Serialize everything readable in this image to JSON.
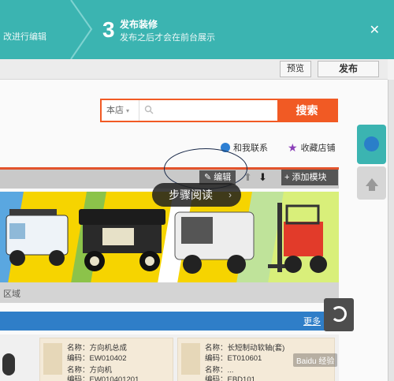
{
  "stepbar": {
    "prev_step_text": "改进行编辑",
    "current_step_number": "3",
    "current_step_title": "发布装修",
    "current_step_subtitle": "发布之后才会在前台展示",
    "close_label": "✕"
  },
  "toolbar": {
    "preview_label": "预览",
    "publish_label": "发布"
  },
  "search": {
    "scope_label": "本店",
    "button_label": "搜索"
  },
  "shop_links": {
    "contact_label": "和我联系",
    "favorite_label": "收藏店铺"
  },
  "module_tools": {
    "edit_label": "编辑",
    "add_module_label": "+ 添加模块"
  },
  "guide": {
    "label": "步骤阅读",
    "chevron": "›"
  },
  "sections": {
    "grey_bar_text": "区域",
    "more_link": "更多"
  },
  "products": [
    {
      "name": "名称：方向机总成",
      "code": "编码：EW010402",
      "name2": "名称：方向机",
      "code2": "编码：EW010401201"
    },
    {
      "name": "名称：长短制动软轴(套)",
      "code": "编码：ET010601",
      "name2": "名称：...",
      "code2": "编码：EBD101..."
    }
  ],
  "watermark": "Baidu 经验",
  "colors": {
    "teal": "#3bb4b1",
    "orange": "#f15a24",
    "blue": "#2f7ec8",
    "banner_yellow": "#f6d400"
  }
}
